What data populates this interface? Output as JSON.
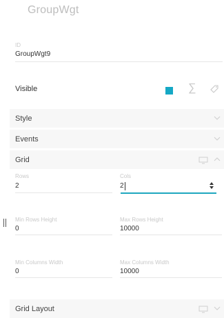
{
  "header": {
    "title": "GroupWgt"
  },
  "properties": {
    "id_label": "ID",
    "id_value": "GroupWgt9",
    "visible_label": "Visible",
    "visible_checked": true
  },
  "sections": {
    "style": "Style",
    "events": "Events",
    "grid": "Grid",
    "grid_layout": "Grid Layout"
  },
  "grid": {
    "rows_label": "Rows",
    "rows_value": "2",
    "cols_label": "Cols",
    "cols_value": "2",
    "min_rows_height_label": "Min Rows Height",
    "min_rows_height_value": "0",
    "max_rows_height_label": "Max Rows Height",
    "max_rows_height_value": "10000",
    "min_columns_width_label": "Min Columns Width",
    "min_columns_width_value": "0",
    "max_columns_width_label": "Max Columns Width",
    "max_columns_width_value": "10000"
  },
  "colors": {
    "accent": "#15a8c5",
    "muted": "#c9c9c9",
    "section_bg": "#f7f7f7"
  },
  "icons": {
    "visible_toggle": "checkbox-filled-icon",
    "formula": "sigma-icon",
    "tag": "tag-icon",
    "chevron": "chevron-down-icon",
    "device": "monitor-icon",
    "spinner": "number-spinner-icon",
    "resize": "resize-handle-icon"
  }
}
